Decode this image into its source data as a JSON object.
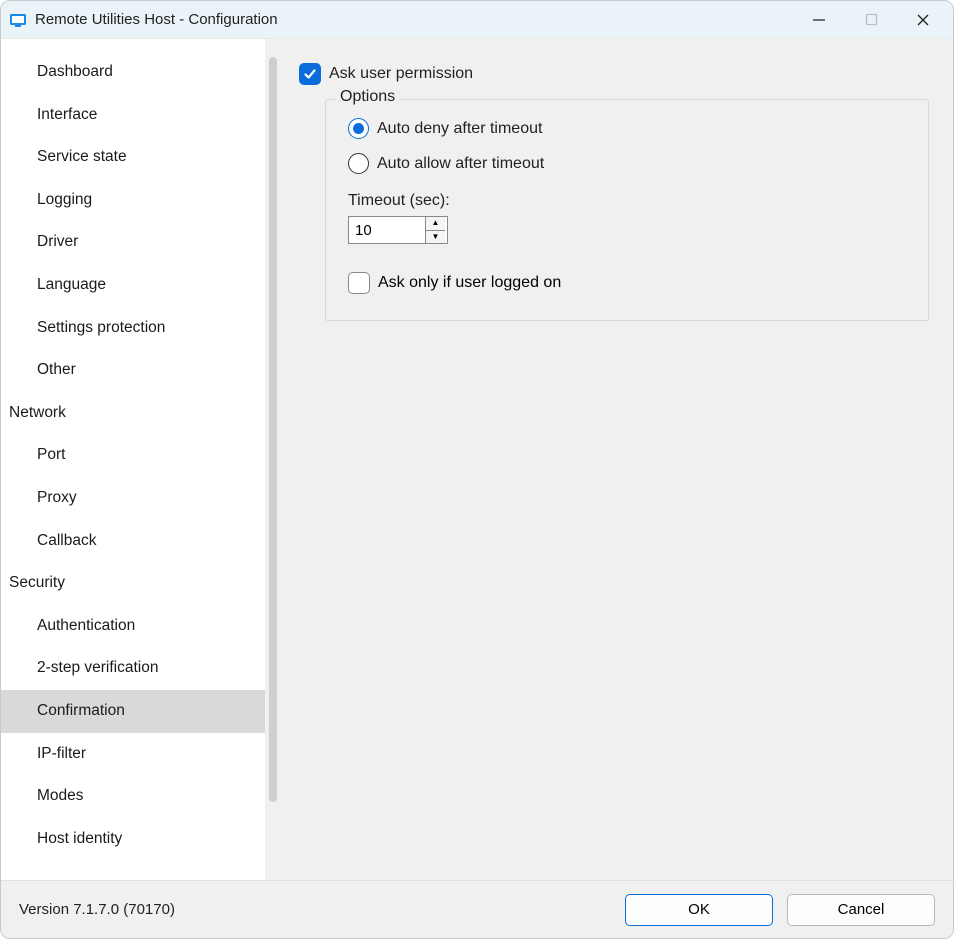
{
  "window": {
    "title": "Remote Utilities Host - Configuration"
  },
  "sidebar": {
    "items": [
      {
        "label": "Dashboard",
        "type": "item"
      },
      {
        "label": "Interface",
        "type": "item"
      },
      {
        "label": "Service state",
        "type": "item"
      },
      {
        "label": "Logging",
        "type": "item"
      },
      {
        "label": "Driver",
        "type": "item"
      },
      {
        "label": "Language",
        "type": "item"
      },
      {
        "label": "Settings protection",
        "type": "item"
      },
      {
        "label": "Other",
        "type": "item"
      },
      {
        "label": "Network",
        "type": "header"
      },
      {
        "label": "Port",
        "type": "item"
      },
      {
        "label": "Proxy",
        "type": "item"
      },
      {
        "label": "Callback",
        "type": "item"
      },
      {
        "label": "Security",
        "type": "header"
      },
      {
        "label": "Authentication",
        "type": "item"
      },
      {
        "label": "2-step verification",
        "type": "item"
      },
      {
        "label": "Confirmation",
        "type": "item",
        "selected": true
      },
      {
        "label": "IP-filter",
        "type": "item"
      },
      {
        "label": "Modes",
        "type": "item"
      },
      {
        "label": "Host identity",
        "type": "item"
      }
    ]
  },
  "content": {
    "ask_permission_label": "Ask user permission",
    "ask_permission_checked": true,
    "options_legend": "Options",
    "radio_auto_deny": "Auto deny after timeout",
    "radio_auto_allow": "Auto allow after timeout",
    "radio_selected": "deny",
    "timeout_label": "Timeout (sec):",
    "timeout_value": "10",
    "ask_only_logged_label": "Ask only if user logged on",
    "ask_only_logged_checked": false
  },
  "footer": {
    "version": "Version 7.1.7.0 (70170)",
    "ok_label": "OK",
    "cancel_label": "Cancel"
  }
}
